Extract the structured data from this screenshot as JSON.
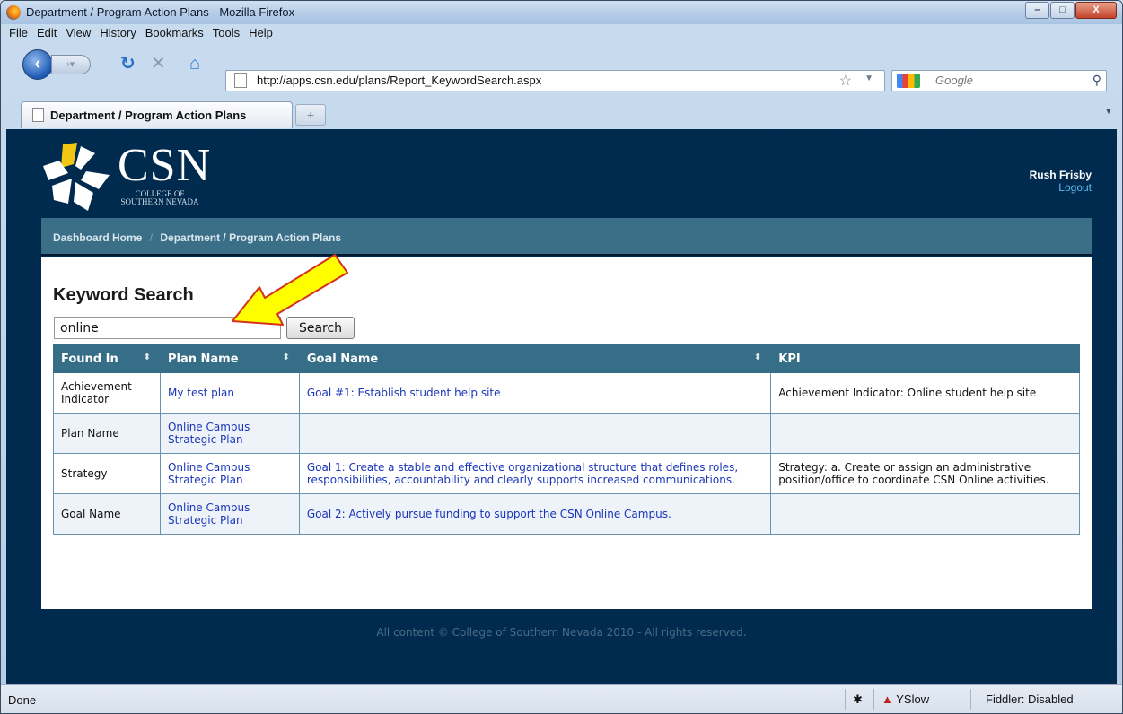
{
  "window": {
    "title": "Department / Program Action Plans - Mozilla Firefox",
    "buttons": {
      "minimize": "–",
      "maximize": "□",
      "close": "X"
    }
  },
  "menu": [
    "File",
    "Edit",
    "View",
    "History",
    "Bookmarks",
    "Tools",
    "Help"
  ],
  "toolbar": {
    "url": "http://apps.csn.edu/plans/Report_KeywordSearch.aspx",
    "search_placeholder": "Google",
    "icons": [
      "back-icon",
      "forward-icon",
      "reload-icon",
      "stop-icon",
      "home-icon",
      "bookmark-star-icon",
      "google-icon",
      "search-icon"
    ]
  },
  "tab": {
    "label": "Department / Program Action Plans",
    "new_tab": "+"
  },
  "site": {
    "logo_text": "CSN",
    "logo_sub_1": "COLLEGE OF",
    "logo_sub_2": "SOUTHERN NEVADA",
    "user_name": "Rush Frisby",
    "logout": "Logout",
    "breadcrumb": [
      "Dashboard Home",
      "Department / Program Action Plans"
    ],
    "breadcrumb_sep": "/"
  },
  "main": {
    "title": "Keyword Search",
    "search_value": "online",
    "search_button": "Search",
    "columns": [
      "Found In",
      "Plan Name",
      "Goal Name",
      "KPI"
    ],
    "sort_icon": "⬍",
    "rows": [
      {
        "found_in": "Achievement Indicator",
        "plan": "My test plan",
        "goal": "Goal #1: Establish student help site",
        "kpi": "Achievement Indicator: Online student help site"
      },
      {
        "found_in": "Plan Name",
        "plan": "Online Campus Strategic Plan",
        "goal": "",
        "kpi": ""
      },
      {
        "found_in": "Strategy",
        "plan": "Online Campus Strategic Plan",
        "goal": "Goal 1: Create a stable and effective organizational structure that defines roles, responsibilities, accountability and clearly supports increased communications.",
        "kpi": "Strategy: a. Create or assign an administrative position/office to coordinate CSN Online activities."
      },
      {
        "found_in": "Goal Name",
        "plan": "Online Campus Strategic Plan",
        "goal": "Goal 2: Actively pursue funding to support the CSN Online Campus.",
        "kpi": ""
      }
    ],
    "footer": "All content © College of Southern Nevada 2010 - All rights reserved."
  },
  "status": {
    "text": "Done",
    "yslow": "YSlow",
    "fiddler": "Fiddler: Disabled"
  },
  "colors": {
    "page_bg": "#002b4e",
    "breadcrumb_bg": "#3a6f87",
    "header_bg": "#356e86",
    "link": "#1a36b8",
    "arrow": "#ffff00"
  }
}
